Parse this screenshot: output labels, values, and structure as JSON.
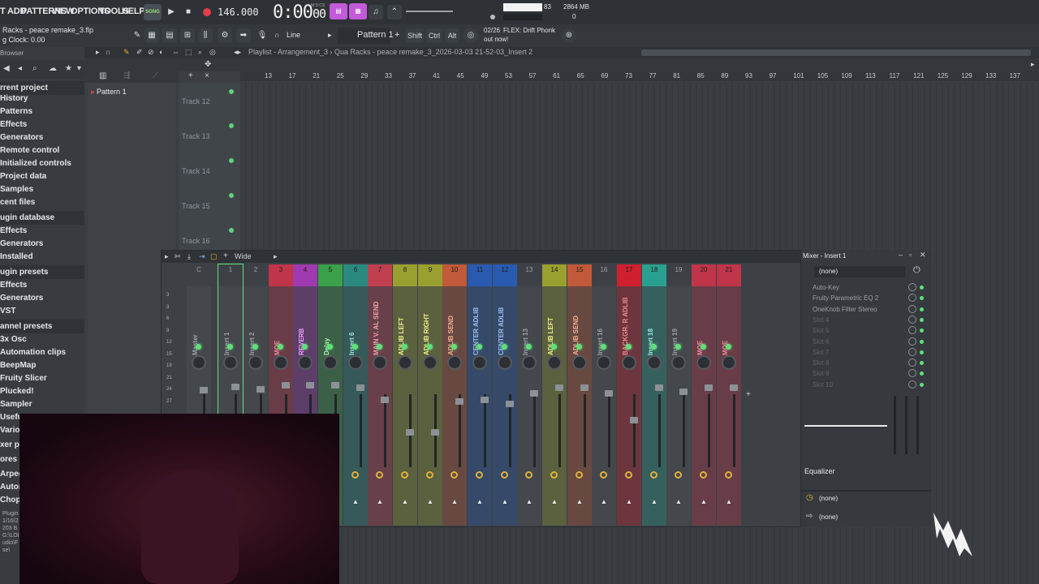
{
  "menu": [
    "T ADD",
    "PATTERNS",
    "VIEW",
    "OPTIONS",
    "TOOLS",
    "HELP"
  ],
  "transport": {
    "song_label": "SONG",
    "tempo": "146.000",
    "clock_main": "0:00",
    "clock_sub": "00",
    "clock_unit": "M:S:CS"
  },
  "toolbar_pink": [
    "▤",
    "▦"
  ],
  "memory": {
    "cpu": "83",
    "ram": "2864 MB",
    "voices": "0"
  },
  "project": {
    "title": "Racks - peace remake_3.flp",
    "clock": "g Clock: 0.00"
  },
  "snap": "Line",
  "pattern_selector": "Pattern 1",
  "keys": [
    "Shift",
    "Ctrl",
    "Alt"
  ],
  "news": {
    "date": "02/26",
    "text": "FLEX: Drift Phonk",
    "sub": "out now!"
  },
  "browser": {
    "title": "Browser",
    "items": [
      {
        "label": "rrent project",
        "type": "header-text"
      },
      {
        "label": "History"
      },
      {
        "label": "Patterns"
      },
      {
        "label": "Effects"
      },
      {
        "label": "Generators"
      },
      {
        "label": "Remote control"
      },
      {
        "label": "Initialized controls"
      },
      {
        "label": "Project data"
      },
      {
        "label": "Samples"
      },
      {
        "label": "cent files"
      }
    ],
    "plugin_db": "ugin database",
    "plugin_db_items": [
      "Effects",
      "Generators",
      "Installed"
    ],
    "plugin_presets": "ugin presets",
    "plugin_presets_items": [
      "Effects",
      "Generators",
      "VST"
    ],
    "channel_presets": "annel presets",
    "channel_items": [
      "3x Osc",
      "Automation clips",
      "BeepMap",
      "Fruity Slicer",
      "Plucked!",
      "Sampler",
      "Usefu",
      "Vario",
      "xer p",
      "ores",
      "Arpeg",
      "Autom",
      "Chopp"
    ],
    "footer": [
      "Plugin",
      "1/16/2",
      "203 B",
      "G:\\LOI",
      "udio\\F",
      "se\\"
    ]
  },
  "playlist": {
    "breadcrumb": "Playlist - Arrangement_3  ›  Qua Racks - peace remake_3_2026-03-03 21-52-03_Insert 2",
    "pattern": "Pattern 1",
    "tracks": [
      "Track 12",
      "Track 13",
      "Track 14",
      "Track 15",
      "Track 16"
    ],
    "ruler": [
      "13",
      "17",
      "21",
      "25",
      "29",
      "33",
      "37",
      "41",
      "45",
      "49",
      "53",
      "57",
      "61",
      "65",
      "69",
      "73",
      "77",
      "81",
      "85",
      "89",
      "93",
      "97",
      "101",
      "105",
      "109",
      "113",
      "117",
      "121",
      "125",
      "129",
      "133",
      "137"
    ]
  },
  "mixer": {
    "mode": "Wide",
    "strips": [
      {
        "num": "C",
        "sub": "M",
        "name": "Master",
        "color": "#3d4146",
        "text": "#9aa0a6"
      },
      {
        "num": "1",
        "name": "Insert 1",
        "color": "#3d4146",
        "text": "#9aa0a6",
        "selected": true
      },
      {
        "num": "2",
        "name": "Insert 2",
        "color": "#3d4146",
        "text": "#9aa0a6"
      },
      {
        "num": "3",
        "name": "MOE",
        "color": "#c0354a",
        "text": "#f08aa0"
      },
      {
        "num": "4",
        "name": "REVERB",
        "color": "#a03ab0",
        "text": "#f0a0f8"
      },
      {
        "num": "5",
        "name": "Delay",
        "color": "#3aa04a",
        "text": "#a8f0b0"
      },
      {
        "num": "6",
        "name": "Insert 6",
        "color": "#2a8a80",
        "text": "#9ae0d8"
      },
      {
        "num": "7",
        "name": "MAIN V. AL SEND",
        "color": "#c04050",
        "text": "#f0a0a8"
      },
      {
        "num": "8",
        "name": "ADLIB LEFT",
        "color": "#9aa030",
        "text": "#f0f08a"
      },
      {
        "num": "9",
        "name": "ADLIB RIGHT",
        "color": "#9aa030",
        "text": "#f0f08a"
      },
      {
        "num": "10",
        "name": "ADLIB SEND",
        "color": "#c05a3a",
        "text": "#f0b090"
      },
      {
        "num": "11",
        "name": "CENTER ADLIB",
        "color": "#2a5ab0",
        "text": "#9ac0f8"
      },
      {
        "num": "12",
        "name": "CENTER ADLIB",
        "color": "#2a5ab0",
        "text": "#9ac0f8"
      },
      {
        "num": "13",
        "name": "Insert 13",
        "color": "#3d4146",
        "text": "#9aa0a6"
      },
      {
        "num": "14",
        "name": "ADLIB LEFT",
        "color": "#9aa030",
        "text": "#f0f08a"
      },
      {
        "num": "15",
        "name": "ADLIB SEND",
        "color": "#c05a3a",
        "text": "#f0b090"
      },
      {
        "num": "16",
        "name": "Insert 16",
        "color": "#3d4146",
        "text": "#9aa0a6"
      },
      {
        "num": "17",
        "name": "BACKGR. R ADLIB",
        "color": "#d02030",
        "text": "#f08a90"
      },
      {
        "num": "18",
        "name": "Insert 18",
        "color": "#2aa090",
        "text": "#9ae8e0"
      },
      {
        "num": "19",
        "name": "Insert 19",
        "color": "#3d4146",
        "text": "#9aa0a6"
      },
      {
        "num": "20",
        "name": "MOE",
        "color": "#c0354a",
        "text": "#f08aa0"
      },
      {
        "num": "21",
        "name": "MOE",
        "color": "#c0354a",
        "text": "#f08aa0"
      }
    ],
    "db_scale": [
      "3",
      "3",
      "6",
      "9",
      "12",
      "15",
      "18",
      "21",
      "24",
      "27"
    ]
  },
  "insert": {
    "title": "Mixer - Insert 1",
    "preset": "(none)",
    "slots": [
      "Auto-Key",
      "Fruity Parametric EQ 2",
      "OneKnob Filter Stereo",
      "Slot 4",
      "Slot 5",
      "Slot 6",
      "Slot 7",
      "Slot 8",
      "Slot 9",
      "Slot 10"
    ],
    "eq_label": "Equalizer",
    "input": "(none)",
    "output": "(none)"
  }
}
